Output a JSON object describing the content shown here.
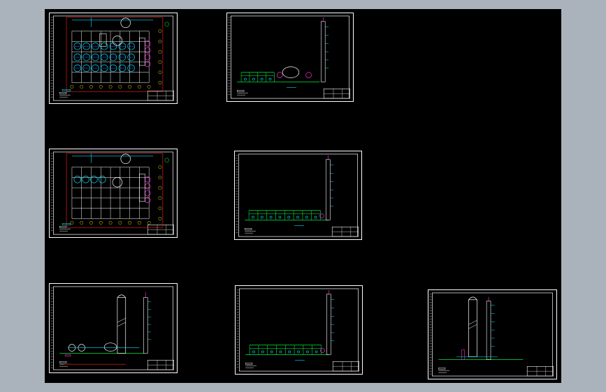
{
  "colors": {
    "workspace_bg": "#aab2bb",
    "canvas_bg": "#000000",
    "frame": "#ffffff",
    "cyan": "#00e5ff",
    "green": "#00cc33",
    "magenta": "#ff2bd6",
    "red": "#ff2222",
    "yellow": "#ffdd00",
    "blue": "#3355ff"
  },
  "sheets": [
    {
      "name": "sheet-plan-upper",
      "kind": "plan-dense"
    },
    {
      "name": "sheet-elevation-upper",
      "kind": "elevation-tank"
    },
    {
      "name": "sheet-plan-middle",
      "kind": "plan-light"
    },
    {
      "name": "sheet-elevation-middle",
      "kind": "elevation-rack"
    },
    {
      "name": "sheet-elevation-lower-left",
      "kind": "elevation-column"
    },
    {
      "name": "sheet-elevation-lower-middle",
      "kind": "elevation-rack"
    },
    {
      "name": "sheet-elevation-lower-right",
      "kind": "elevation-tower"
    }
  ]
}
